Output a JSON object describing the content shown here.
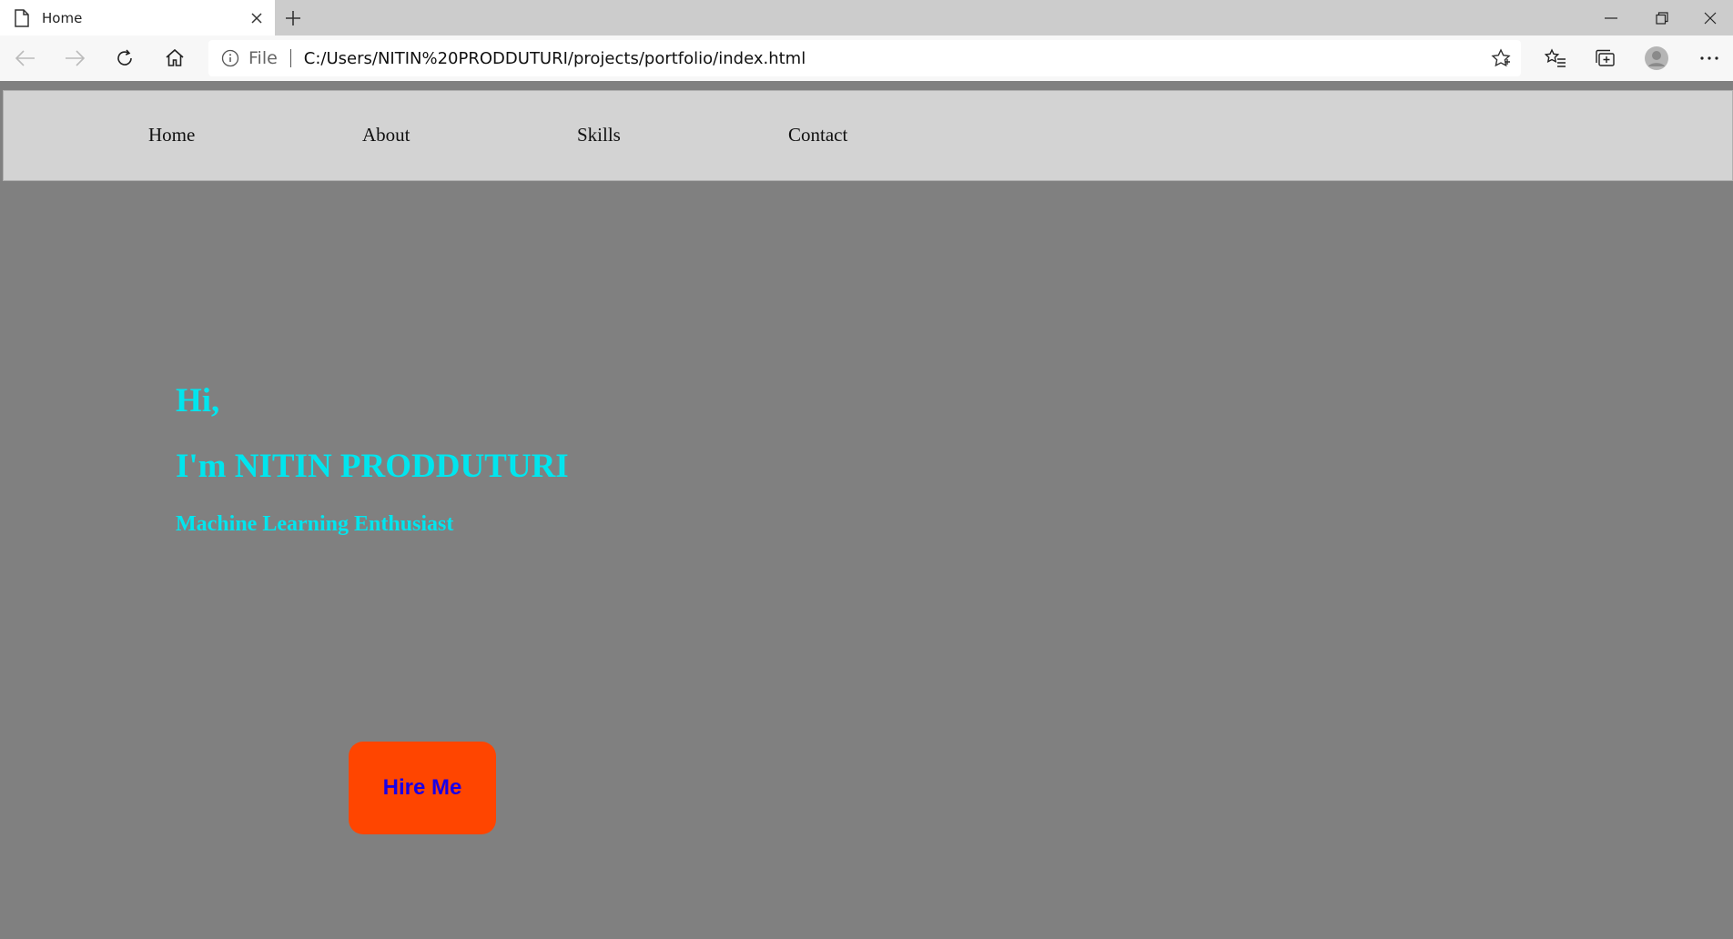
{
  "browser": {
    "tab": {
      "title": "Home",
      "icon": "page-icon"
    },
    "address_bar": {
      "scheme_label": "File",
      "url": "C:/Users/NITIN%20PRODDUTURI/projects/portfolio/index.html"
    }
  },
  "page": {
    "colors": {
      "background": "#808080",
      "navbar": "#d3d3d3",
      "hero_text": "#00e5ee",
      "button_bg": "#ff4500",
      "button_text": "#1a00e6"
    },
    "nav": {
      "items": [
        {
          "label": "Home"
        },
        {
          "label": "About"
        },
        {
          "label": "Skills"
        },
        {
          "label": "Contact"
        }
      ]
    },
    "hero": {
      "greeting": "Hi,",
      "name_line": "I'm NITIN PRODDUTURI",
      "tagline": "Machine Learning Enthusiast"
    },
    "cta": {
      "label": "Hire Me"
    }
  }
}
